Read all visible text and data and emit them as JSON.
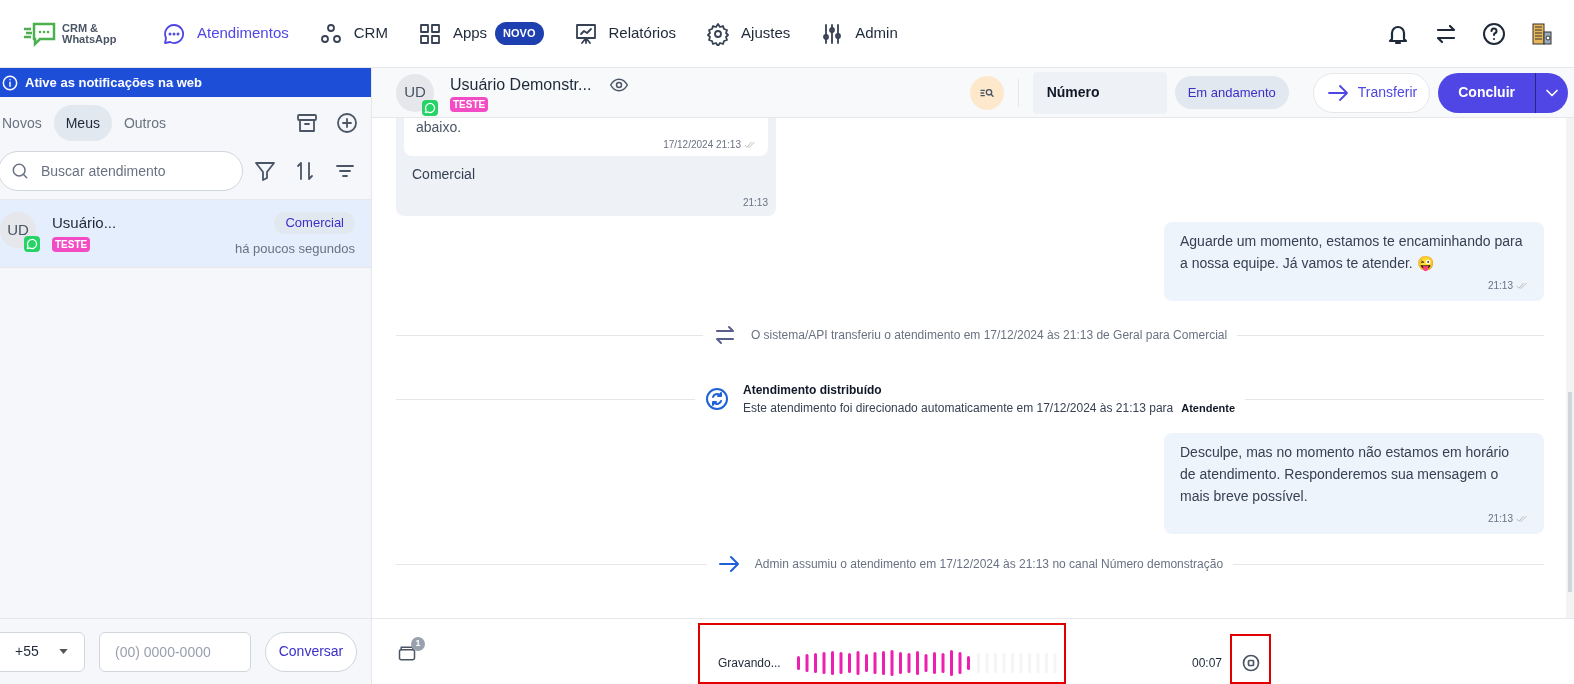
{
  "logo": {
    "text": "CRM & WhatsApp"
  },
  "nav": [
    {
      "label": "Atendimentos",
      "selected": true
    },
    {
      "label": "CRM",
      "selected": false
    },
    {
      "label": "Apps",
      "selected": false,
      "badge": "NOVO"
    },
    {
      "label": "Relatórios",
      "selected": false
    },
    {
      "label": "Ajustes",
      "selected": false
    },
    {
      "label": "Admin",
      "selected": false
    }
  ],
  "sidebar": {
    "banner": "Ative as notificações na web",
    "tabs": [
      {
        "label": "Novos",
        "selected": false
      },
      {
        "label": "Meus",
        "selected": true
      },
      {
        "label": "Outros",
        "selected": false
      }
    ],
    "search": {
      "placeholder": "Buscar atendimento"
    },
    "conversations": [
      {
        "initials": "UD",
        "name": "Usuário...",
        "tag": "TESTE",
        "queue": "Comercial",
        "time": "há poucos segundos",
        "selected": true
      }
    ],
    "footer": {
      "country_code": "+55",
      "phone_placeholder": "(00) 0000-0000",
      "button": "Conversar"
    }
  },
  "chat_header": {
    "initials": "UD",
    "name": "Usuário Demonstr...",
    "tag": "TESTE",
    "number_label": "Número",
    "status": "Em andamento",
    "transfer": "Transferir",
    "conclude": "Concluir"
  },
  "messages": [
    {
      "kind": "received",
      "quote_text": "abaixo.",
      "quote_time": "17/12/2024 21:13",
      "text": "Comercial",
      "time": "21:13"
    },
    {
      "kind": "sent",
      "text": "Aguarde um momento, estamos te encaminhando para a nossa equipe. Já vamos te atender. 😜",
      "time": "21:13"
    },
    {
      "kind": "transfer",
      "text": "O sistema/API transferiu o atendimento em 17/12/2024 às 21:13 de Geral para Comercial"
    },
    {
      "kind": "distributed",
      "title": "Atendimento distribuído",
      "text": "Este atendimento foi direcionado automaticamente em 17/12/2024 às 21:13 para",
      "agent": "Atendente"
    },
    {
      "kind": "sent",
      "text": "Desculpe, mas no momento não estamos em horário de atendimento. Responderemos sua mensagem o mais breve possível.",
      "time": "21:13"
    },
    {
      "kind": "assumed",
      "text": "Admin assumiu o atendimento em 17/12/2024 às 21:13 no canal Número demonstração"
    }
  ],
  "composer": {
    "attachment_count": "1",
    "recording_label": "Gravando...",
    "duration": "00:07"
  }
}
